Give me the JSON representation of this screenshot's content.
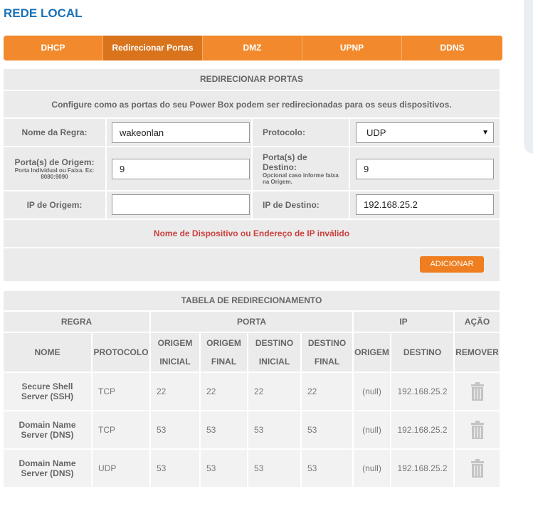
{
  "page_title": "REDE LOCAL",
  "tabs": [
    {
      "label": "DHCP",
      "active": false
    },
    {
      "label": "Redirecionar Portas",
      "active": true
    },
    {
      "label": "DMZ",
      "active": false
    },
    {
      "label": "UPNP",
      "active": false
    },
    {
      "label": "DDNS",
      "active": false
    }
  ],
  "form": {
    "title": "REDIRECIONAR PORTAS",
    "description": "Configure como as portas do seu Power Box podem ser redirecionadas para os seus dispositivos.",
    "rule_name_label": "Nome da Regra:",
    "rule_name_value": "wakeonlan",
    "protocol_label": "Protocolo:",
    "protocol_value": "UDP",
    "origin_ports_label": "Porta(s) de Origem:",
    "origin_ports_hint": "Porta Individual ou Faixa. Ex: 8080:9090",
    "origin_ports_value": "9",
    "dest_ports_label": "Porta(s) de Destino:",
    "dest_ports_hint": "Opcional caso informe faixa na Origem.",
    "dest_ports_value": "9",
    "origin_ip_label": "IP de Origem:",
    "origin_ip_value": "",
    "dest_ip_label": "IP de Destino:",
    "dest_ip_value": "192.168.25.2",
    "error_message": "Nome de Dispositivo ou Endereço de IP inválido",
    "add_button": "ADICIONAR"
  },
  "table": {
    "title": "TABELA DE REDIRECIONAMENTO",
    "group_headers": {
      "rule": "REGRA",
      "port": "PORTA",
      "ip": "IP",
      "action": "AÇÃO"
    },
    "columns": {
      "name": "NOME",
      "protocol": "PROTOCOLO",
      "origin_start": "ORIGEM INICIAL",
      "origin_end": "ORIGEM FINAL",
      "dest_start": "DESTINO INICIAL",
      "dest_end": "DESTINO FINAL",
      "ip_origin": "ORIGEM",
      "ip_dest": "DESTINO",
      "remove": "REMOVER"
    },
    "rows": [
      {
        "name": "Secure Shell Server (SSH)",
        "protocol": "TCP",
        "origin_start": "22",
        "origin_end": "22",
        "dest_start": "22",
        "dest_end": "22",
        "ip_origin": "(null)",
        "ip_dest": "192.168.25.2",
        "action_icon": "trash-icon"
      },
      {
        "name": "Domain Name Server (DNS)",
        "protocol": "TCP",
        "origin_start": "53",
        "origin_end": "53",
        "dest_start": "53",
        "dest_end": "53",
        "ip_origin": "(null)",
        "ip_dest": "192.168.25.2",
        "action_icon": "trash-icon"
      },
      {
        "name": "Domain Name Server (DNS)",
        "protocol": "UDP",
        "origin_start": "53",
        "origin_end": "53",
        "dest_start": "53",
        "dest_end": "53",
        "ip_origin": "(null)",
        "ip_dest": "192.168.25.2",
        "action_icon": "trash-icon"
      }
    ]
  },
  "colors": {
    "accent_orange": "#f28a2d",
    "active_tab": "#d9741d",
    "title_blue": "#1a72b8",
    "error_red": "#c9413f",
    "panel_gray": "#ebebeb"
  }
}
